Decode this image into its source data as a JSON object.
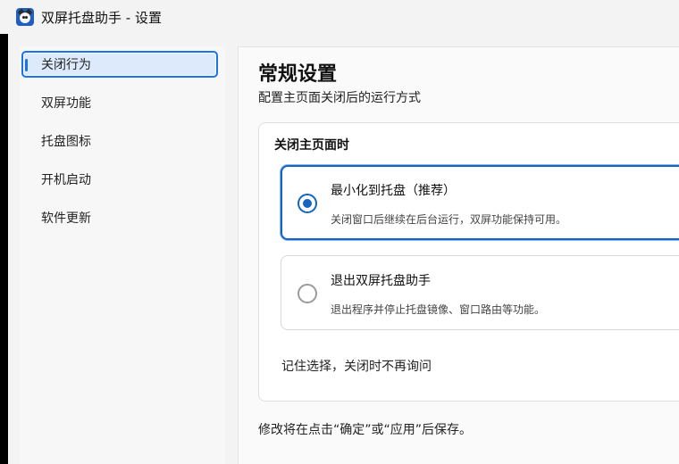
{
  "window": {
    "title": "双屏托盘助手 - 设置",
    "icon": "cat-app-icon"
  },
  "sidebar": {
    "items": [
      {
        "label": "关闭行为",
        "active": true
      },
      {
        "label": "双屏功能",
        "active": false
      },
      {
        "label": "托盘图标",
        "active": false
      },
      {
        "label": "开机启动",
        "active": false
      },
      {
        "label": "软件更新",
        "active": false
      }
    ]
  },
  "main": {
    "title": "常规设置",
    "subtitle": "配置主页面关闭后的运行方式",
    "group": {
      "title": "关闭主页面时",
      "options": [
        {
          "label": "最小化到托盘（推荐）",
          "description": "关闭窗口后继续在后台运行，双屏功能保持可用。",
          "selected": true
        },
        {
          "label": "退出双屏托盘助手",
          "description": "退出程序并停止托盘镜像、窗口路由等功能。",
          "selected": false
        }
      ],
      "remember_label": "记住选择，关闭时不再询问"
    },
    "footer_note": "修改将在点击“确定”或“应用”后保存。"
  },
  "colors": {
    "accent": "#1565c0",
    "nav_active_bg": "#dceafb",
    "window_bg": "#f3f3f3"
  }
}
